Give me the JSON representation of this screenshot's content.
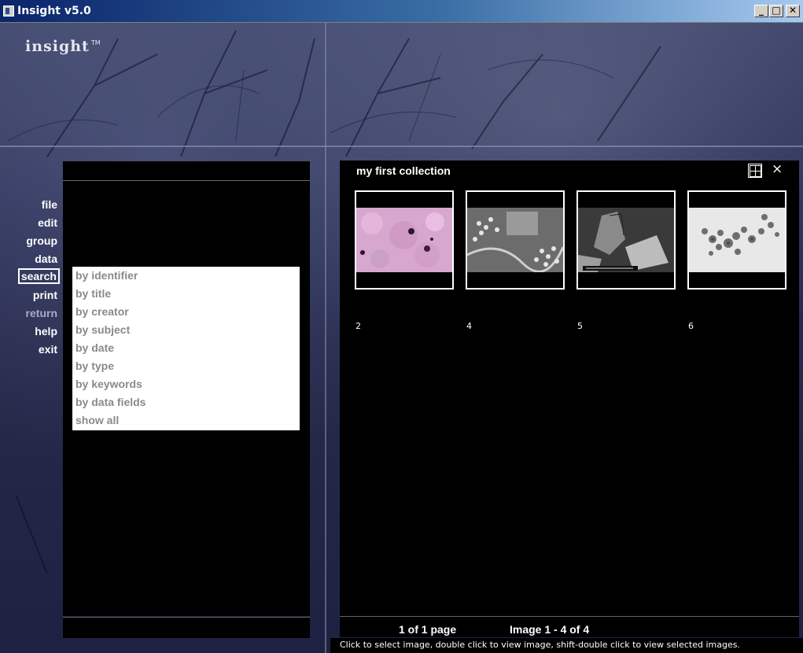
{
  "window": {
    "title": "Insight v5.0",
    "minimize": "_",
    "maximize": "□",
    "close": "✕"
  },
  "logo": {
    "text": "insight",
    "tm": "TM"
  },
  "menu": [
    {
      "label": "file"
    },
    {
      "label": "edit"
    },
    {
      "label": "group"
    },
    {
      "label": "data"
    },
    {
      "label": "search",
      "active": true
    },
    {
      "label": "print"
    },
    {
      "label": "return",
      "dim": true
    },
    {
      "label": "help"
    },
    {
      "label": "exit"
    }
  ],
  "search_submenu": [
    "by identifier",
    "by title",
    "by creator",
    "by subject",
    "by date",
    "by type",
    "by keywords",
    "by data fields",
    "show all"
  ],
  "collection": {
    "title": "my first collection",
    "view_icon": "grid-view-icon",
    "close_icon": "close-icon",
    "close_glyph": "×",
    "thumbnails": [
      {
        "label": "2",
        "kind": "pink-cells"
      },
      {
        "label": "4",
        "kind": "virus-particles"
      },
      {
        "label": "5",
        "kind": "crystal-sem"
      },
      {
        "label": "6",
        "kind": "grey-particles"
      }
    ],
    "page_info": "1 of 1 page",
    "image_range": "Image 1 - 4 of 4"
  },
  "hint": "Click to select image, double click to view image, shift-double click to view selected images."
}
